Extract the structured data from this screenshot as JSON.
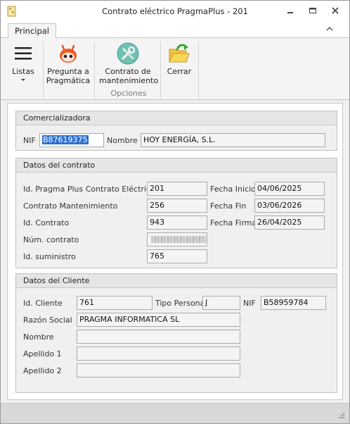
{
  "window": {
    "title": "Contrato eléctrico PragmaPlus - 201"
  },
  "ribbon": {
    "tab": "Principal",
    "buttons": {
      "listas": "Listas",
      "pregunta_l1": "Pregunta a",
      "pregunta_l2": "Pragmática",
      "contrato_l1": "Contrato de",
      "contrato_l2": "mantenimiento",
      "cerrar": "Cerrar"
    },
    "group_label": "Opciones"
  },
  "comercializadora": {
    "header": "Comercializadora",
    "nif_label": "NIF",
    "nif_value": "B87619375",
    "nombre_label": "Nombre",
    "nombre_value": "HOY ENERGÍA, S.L."
  },
  "contrato": {
    "header": "Datos del contrato",
    "id_pragma_label": "Id. Pragma Plus Contrato Eléctrico",
    "id_pragma_value": "201",
    "fecha_inicio_label": "Fecha Inicio",
    "fecha_inicio_value": "04/06/2025",
    "contrato_mant_label": "Contrato Mantenimiento",
    "contrato_mant_value": "256",
    "fecha_fin_label": "Fecha Fin",
    "fecha_fin_value": "03/06/2026",
    "id_contrato_label": "Id. Contrato",
    "id_contrato_value": "943",
    "fecha_firma_label": "Fecha Firma",
    "fecha_firma_value": "26/04/2025",
    "num_contrato_label": "Núm. contrato",
    "id_suministro_label": "Id. suministro",
    "id_suministro_value": "765"
  },
  "cliente": {
    "header": "Datos del Cliente",
    "id_cliente_label": "Id. Cliente",
    "id_cliente_value": "761",
    "tipo_persona_label": "Tipo Persona",
    "tipo_persona_value": "J",
    "nif_label": "NIF",
    "nif_value": "B58959784",
    "razon_social_label": "Razón Social",
    "razon_social_value": "PRAGMA INFORMATICA SL",
    "nombre_label": "Nombre",
    "nombre_value": "",
    "apellido1_label": "Apellido 1",
    "apellido1_value": "",
    "apellido2_label": "Apellido 2",
    "apellido2_value": ""
  },
  "colors": {
    "selection": "#2e6fd0",
    "field_border": "#ababab",
    "group_header": "#e6e6e6"
  },
  "icons": [
    "app-icon",
    "minimize-icon",
    "restore-icon",
    "close-icon",
    "collapse-ribbon-icon",
    "hamburger-menu-icon",
    "robot-icon",
    "tools-icon",
    "folder-exit-icon",
    "resize-grip-icon"
  ]
}
